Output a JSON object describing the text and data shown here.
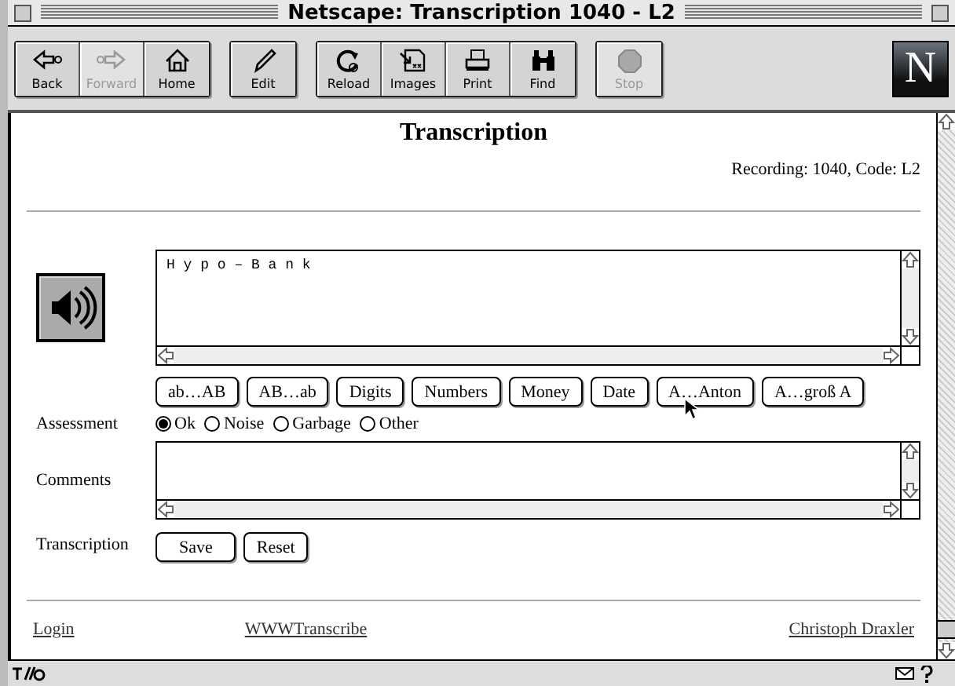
{
  "window": {
    "title": "Netscape: Transcription 1040 - L2"
  },
  "toolbar": {
    "groups": [
      [
        {
          "label": "Back",
          "kind": "back",
          "disabled": false
        },
        {
          "label": "Forward",
          "kind": "forward",
          "disabled": true
        },
        {
          "label": "Home",
          "kind": "home",
          "disabled": false
        }
      ],
      [
        {
          "label": "Edit",
          "kind": "edit",
          "disabled": false
        }
      ],
      [
        {
          "label": "Reload",
          "kind": "reload",
          "disabled": false
        },
        {
          "label": "Images",
          "kind": "images",
          "disabled": false
        },
        {
          "label": "Print",
          "kind": "print",
          "disabled": false
        },
        {
          "label": "Find",
          "kind": "find",
          "disabled": false
        }
      ],
      [
        {
          "label": "Stop",
          "kind": "stop",
          "disabled": true
        }
      ]
    ],
    "logo": "N"
  },
  "page": {
    "heading": "Transcription",
    "info": "Recording: 1040, Code: L2",
    "transcription": {
      "value": "H y p o – B a n k"
    },
    "shortcut_buttons": [
      "ab…AB",
      "AB…ab",
      "Digits",
      "Numbers",
      "Money",
      "Date",
      "A…Anton",
      "A…groß A"
    ],
    "assessment": {
      "label": "Assessment",
      "options": [
        {
          "label": "Ok",
          "selected": true
        },
        {
          "label": "Noise",
          "selected": false
        },
        {
          "label": "Garbage",
          "selected": false
        },
        {
          "label": "Other",
          "selected": false
        }
      ]
    },
    "comments": {
      "label": "Comments"
    },
    "transcription_row": {
      "label": "Transcription",
      "buttons": [
        "Save",
        "Reset"
      ]
    },
    "footer_links": [
      "Login",
      "WWWTranscribe",
      "Christoph Draxler"
    ]
  }
}
